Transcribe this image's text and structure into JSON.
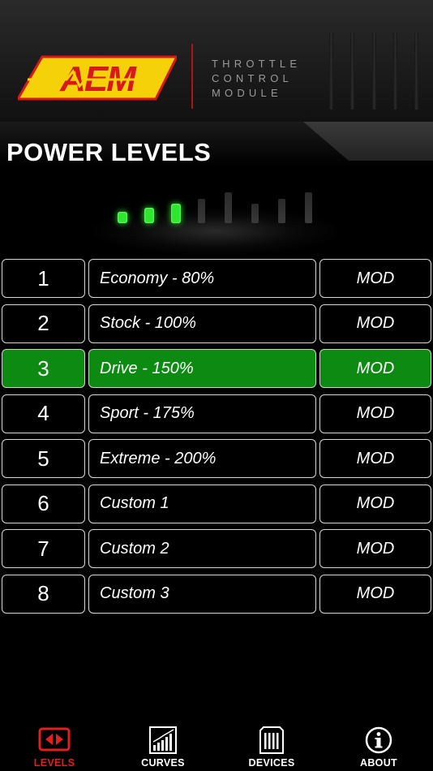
{
  "header": {
    "brand": "AEM",
    "tagline": [
      "THROTTLE",
      "CONTROL",
      "MODULE"
    ],
    "brand_colors": {
      "yellow": "#f5d10a",
      "red": "#d7181c",
      "divider": "#b01515"
    }
  },
  "page_title": "POWER LEVELS",
  "indicator": {
    "active_level": 3,
    "total_levels": 8,
    "active_color": "#2ee62e",
    "inactive_color": "#3a3a3a"
  },
  "levels": [
    {
      "number": "1",
      "name": "Economy - 80%",
      "mod": "MOD",
      "active": false
    },
    {
      "number": "2",
      "name": "Stock - 100%",
      "mod": "MOD",
      "active": false
    },
    {
      "number": "3",
      "name": "Drive - 150%",
      "mod": "MOD",
      "active": true
    },
    {
      "number": "4",
      "name": "Sport - 175%",
      "mod": "MOD",
      "active": false
    },
    {
      "number": "5",
      "name": "Extreme - 200%",
      "mod": "MOD",
      "active": false
    },
    {
      "number": "6",
      "name": "Custom 1",
      "mod": "MOD",
      "active": false
    },
    {
      "number": "7",
      "name": "Custom 2",
      "mod": "MOD",
      "active": false
    },
    {
      "number": "8",
      "name": "Custom 3",
      "mod": "MOD",
      "active": false
    }
  ],
  "active_row_color": "#0d8a12",
  "nav": {
    "items": [
      {
        "label": "LEVELS",
        "icon": "levels-icon",
        "active": true
      },
      {
        "label": "CURVES",
        "icon": "curves-icon",
        "active": false
      },
      {
        "label": "DEVICES",
        "icon": "devices-icon",
        "active": false
      },
      {
        "label": "ABOUT",
        "icon": "about-icon",
        "active": false
      }
    ],
    "active_color": "#e02020"
  }
}
